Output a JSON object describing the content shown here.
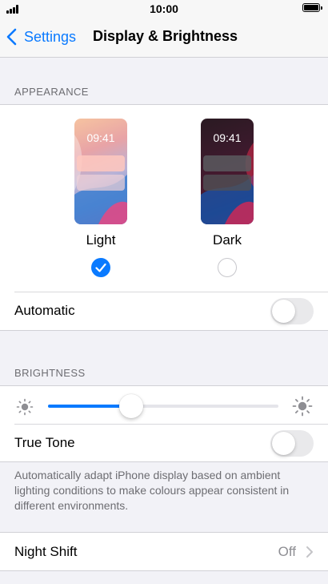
{
  "status_bar": {
    "time": "10:00"
  },
  "navbar": {
    "back_label": "Settings",
    "title": "Display & Brightness"
  },
  "appearance": {
    "header": "APPEARANCE",
    "options": [
      {
        "label": "Light",
        "preview_time": "09:41",
        "selected": true
      },
      {
        "label": "Dark",
        "preview_time": "09:41",
        "selected": false
      }
    ],
    "automatic": {
      "label": "Automatic",
      "on": false
    }
  },
  "brightness": {
    "header": "BRIGHTNESS",
    "level_fraction": 0.36,
    "true_tone": {
      "label": "True Tone",
      "on": false
    },
    "footnote": "Automatically adapt iPhone display based on ambient lighting conditions to make colours appear consistent in different environments."
  },
  "night_shift": {
    "label": "Night Shift",
    "value": "Off"
  },
  "colors": {
    "accent": "#0a7aff",
    "background": "#f2f2f7",
    "secondary_text": "#6d6d72"
  },
  "icons": [
    "signal-icon",
    "battery-icon",
    "back-chevron-icon",
    "checkmark-icon",
    "sun-small-icon",
    "sun-large-icon",
    "chevron-right-icon"
  ]
}
